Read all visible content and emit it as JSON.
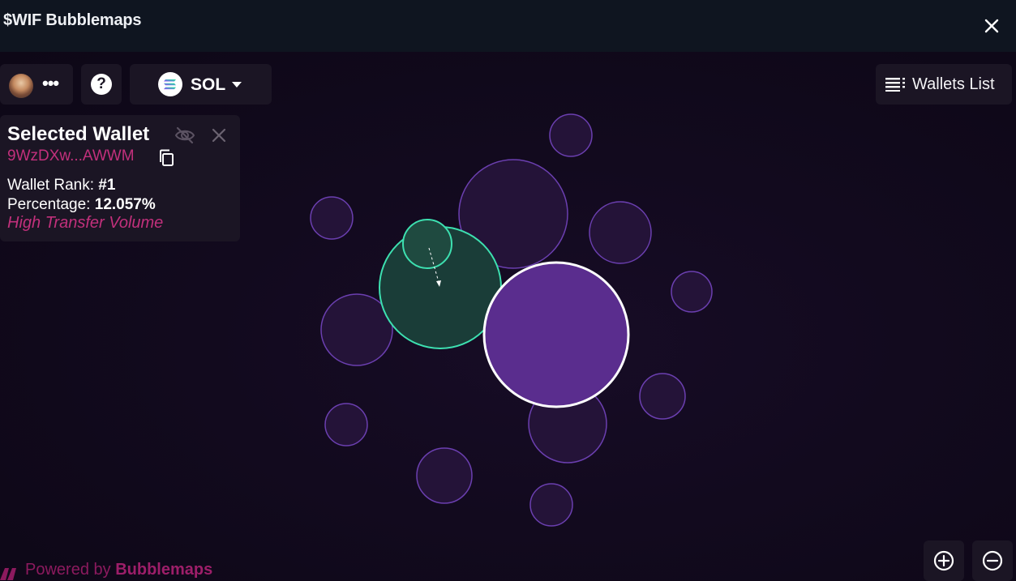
{
  "window": {
    "title": "$WIF Bubblemaps"
  },
  "toolbar": {
    "user_dots": "•••",
    "help_label": "?",
    "chain_label": "SOL",
    "wallets_list_label": "Wallets List"
  },
  "selected_wallet": {
    "title": "Selected Wallet",
    "address": "9WzDXw...AWWM",
    "rank_label": "Wallet Rank:",
    "rank_value": "#1",
    "percentage_label": "Percentage:",
    "percentage_value": "12.057%",
    "tag": "High Transfer Volume"
  },
  "footer": {
    "powered_prefix": "Powered by",
    "powered_brand": "Bubblemaps"
  },
  "colors": {
    "accent_pink": "#c2307c",
    "bubble_purple": "#5a2d8e",
    "bubble_outline": "#6b3fb0",
    "cluster_green": "#1a3d38",
    "cluster_outline": "#3de0b0",
    "background": "#0e0817",
    "panel": "#1b1524"
  },
  "icons": {
    "close": "close-icon",
    "hide": "eye-off-icon",
    "copy": "copy-icon",
    "list": "list-icon",
    "zoom_in": "zoom-in-icon",
    "zoom_out": "zoom-out-icon",
    "chain": "solana-logo-icon"
  }
}
